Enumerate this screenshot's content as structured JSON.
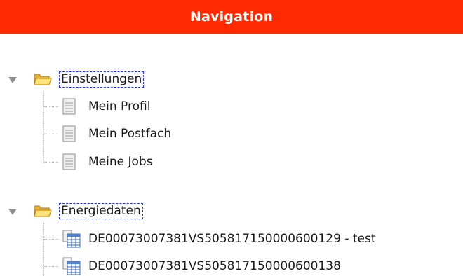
{
  "header": {
    "title": "Navigation",
    "background_color": "#ff2a00"
  },
  "tree": {
    "folders": [
      {
        "label": "Einstellungen",
        "icon": "folder-open-icon",
        "expanded": true,
        "items": [
          {
            "label": "Mein Profil",
            "icon": "document-icon"
          },
          {
            "label": "Mein Postfach",
            "icon": "document-icon"
          },
          {
            "label": "Meine Jobs",
            "icon": "document-icon"
          }
        ]
      },
      {
        "label": "Energiedaten",
        "icon": "folder-open-icon",
        "expanded": true,
        "items": [
          {
            "label": "DE00073007381VS505817150000600129 - test",
            "icon": "spreadsheet-document-icon"
          },
          {
            "label": "DE00073007381VS505817150000600138",
            "icon": "spreadsheet-document-icon"
          }
        ]
      }
    ]
  }
}
